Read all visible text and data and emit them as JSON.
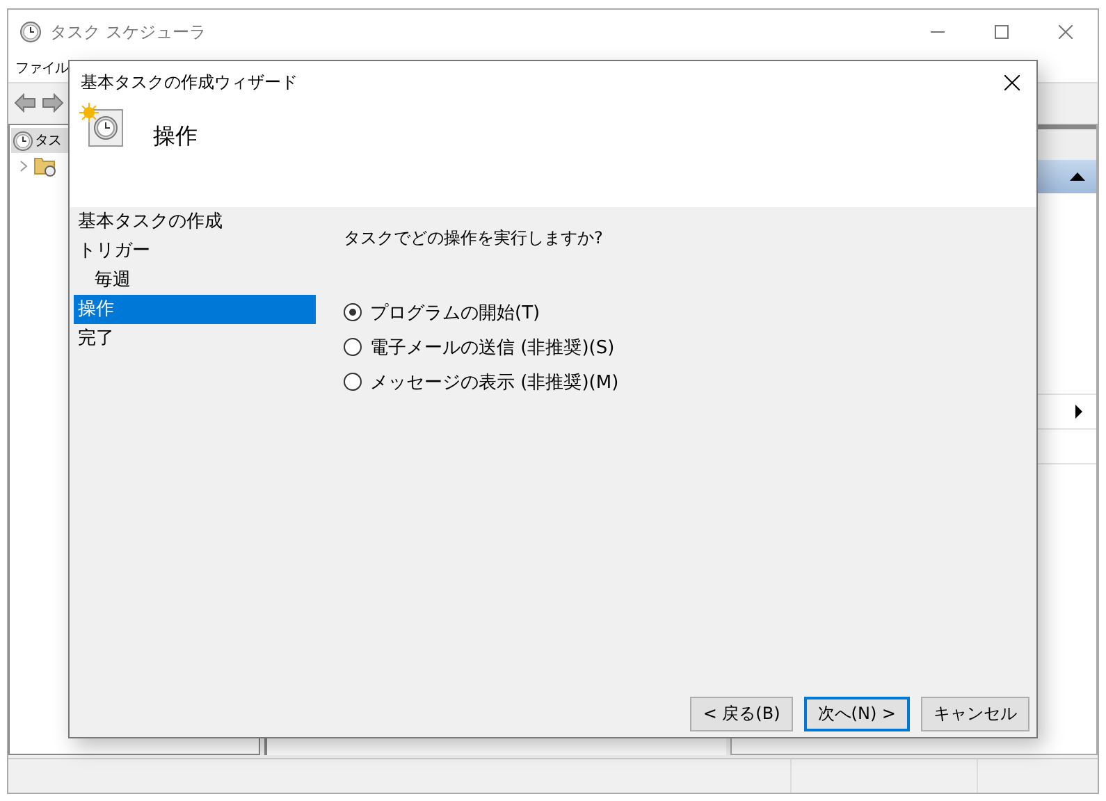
{
  "main_window": {
    "title": "タスク スケジューラ",
    "menu": [
      "ファイル"
    ],
    "tree": [
      {
        "label": "タス",
        "selected": true
      }
    ]
  },
  "dialog": {
    "title": "基本タスクの作成ウィザード",
    "heading": "操作",
    "steps": [
      {
        "label": "基本タスクの作成",
        "selected": false
      },
      {
        "label": "トリガー",
        "selected": false,
        "children": [
          {
            "label": "毎週",
            "selected": false
          }
        ]
      },
      {
        "label": "操作",
        "selected": true
      },
      {
        "label": "完了",
        "selected": false
      }
    ],
    "question": "タスクでどの操作を実行しますか?",
    "options": [
      {
        "label": "プログラムの開始(T)",
        "selected": true
      },
      {
        "label": "電子メールの送信 (非推奨)(S)",
        "selected": false
      },
      {
        "label": "メッセージの表示 (非推奨)(M)",
        "selected": false
      }
    ],
    "buttons": [
      {
        "label": "< 戻る(B)",
        "default": false
      },
      {
        "label": "次へ(N) >",
        "default": true
      },
      {
        "label": "キャンセル",
        "default": false
      }
    ]
  }
}
